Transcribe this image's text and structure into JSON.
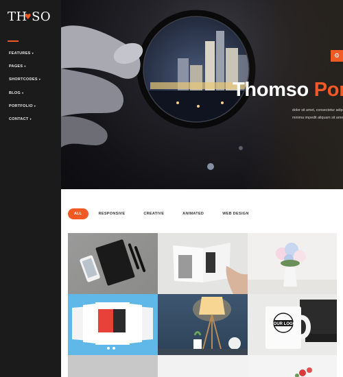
{
  "logo": {
    "part1": "TH",
    "accent": "♥",
    "part2": "SO"
  },
  "nav": [
    {
      "label": "FEATURES"
    },
    {
      "label": "PAGES"
    },
    {
      "label": "SHORTCODES"
    },
    {
      "label": "BLOG"
    },
    {
      "label": "PORTFOLIO"
    },
    {
      "label": "CONTACT"
    }
  ],
  "nav_caret": "▾",
  "hero": {
    "title_white": "Thomso",
    "title_orange": "Portfolio",
    "subtitle_line1": "dolor sit amet, consectetur adipisicing elit. Excepturi vero",
    "subtitle_line2": "minima impedit aliquam sit amet. Lorem ipsum dolor sit amet",
    "toggle_icon": "⚙"
  },
  "filters": [
    "ALL",
    "RESPONSIVE",
    "CREATIVE",
    "ANIMATED",
    "WEB DESIGN"
  ],
  "tile4_logo_text": "YOUR LOGO",
  "colors": {
    "accent": "#f15a24",
    "sidebar": "#1b1b1b"
  }
}
